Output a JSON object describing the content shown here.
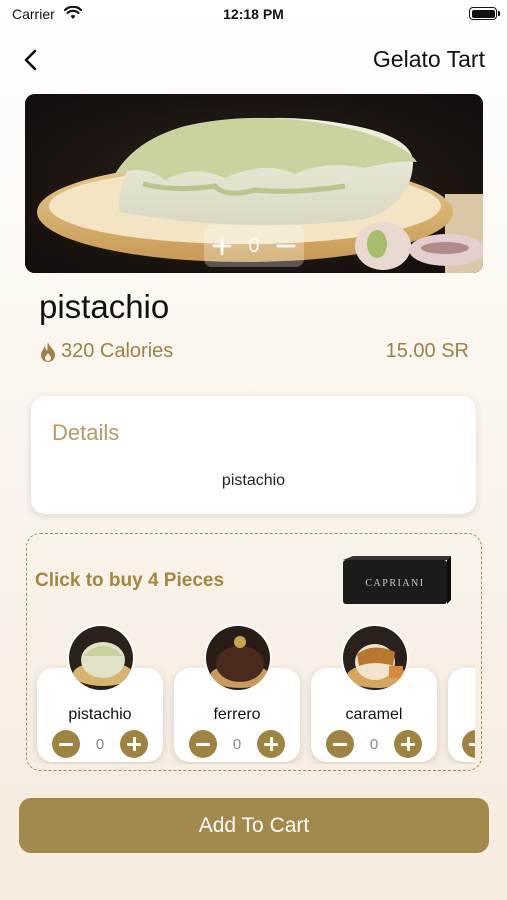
{
  "status_bar": {
    "carrier": "Carrier",
    "time": "12:18 PM"
  },
  "nav": {
    "title": "Gelato Tart",
    "back_icon": "chevron-left-icon"
  },
  "hero": {
    "quantity": "0",
    "plus_icon": "plus-icon",
    "minus_icon": "minus-icon"
  },
  "product": {
    "name": "pistachio",
    "calories": "320 Calories",
    "calories_icon": "flame-icon",
    "price": "15.00 SR"
  },
  "details": {
    "title": "Details",
    "text": "pistachio"
  },
  "bundle": {
    "title": "Click to buy 4 Pieces",
    "box_label": "CAPRIANI",
    "items": [
      {
        "name": "pistachio",
        "quantity": "0"
      },
      {
        "name": "ferrero",
        "quantity": "0"
      },
      {
        "name": "caramel",
        "quantity": "0"
      }
    ]
  },
  "cart_button": {
    "label": "Add To Cart"
  },
  "colors": {
    "accent": "#a38a4c",
    "accent_text": "#9c8243",
    "details_title": "#b49a66"
  }
}
